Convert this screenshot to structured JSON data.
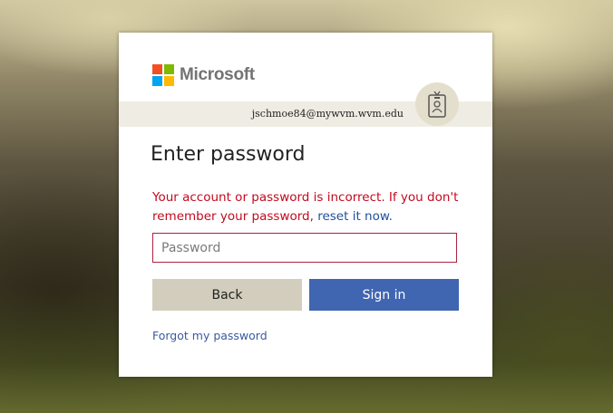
{
  "brand": {
    "name": "Microsoft",
    "colors": [
      "#f25022",
      "#7fba00",
      "#00a4ef",
      "#ffb900"
    ]
  },
  "identity": {
    "email": "jschmoe84@mywvm.wvm.edu",
    "icon": "id-badge-icon"
  },
  "form": {
    "title": "Enter password",
    "error_text": "Your account or password is incorrect. If you don't remember your password, ",
    "error_link": "reset it now.",
    "password_placeholder": "Password",
    "back_label": "Back",
    "signin_label": "Sign in",
    "forgot_label": "Forgot my password"
  },
  "colors": {
    "error": "#c20a1f",
    "primary_button": "#4065b1",
    "secondary_button": "#d2cdbd"
  }
}
